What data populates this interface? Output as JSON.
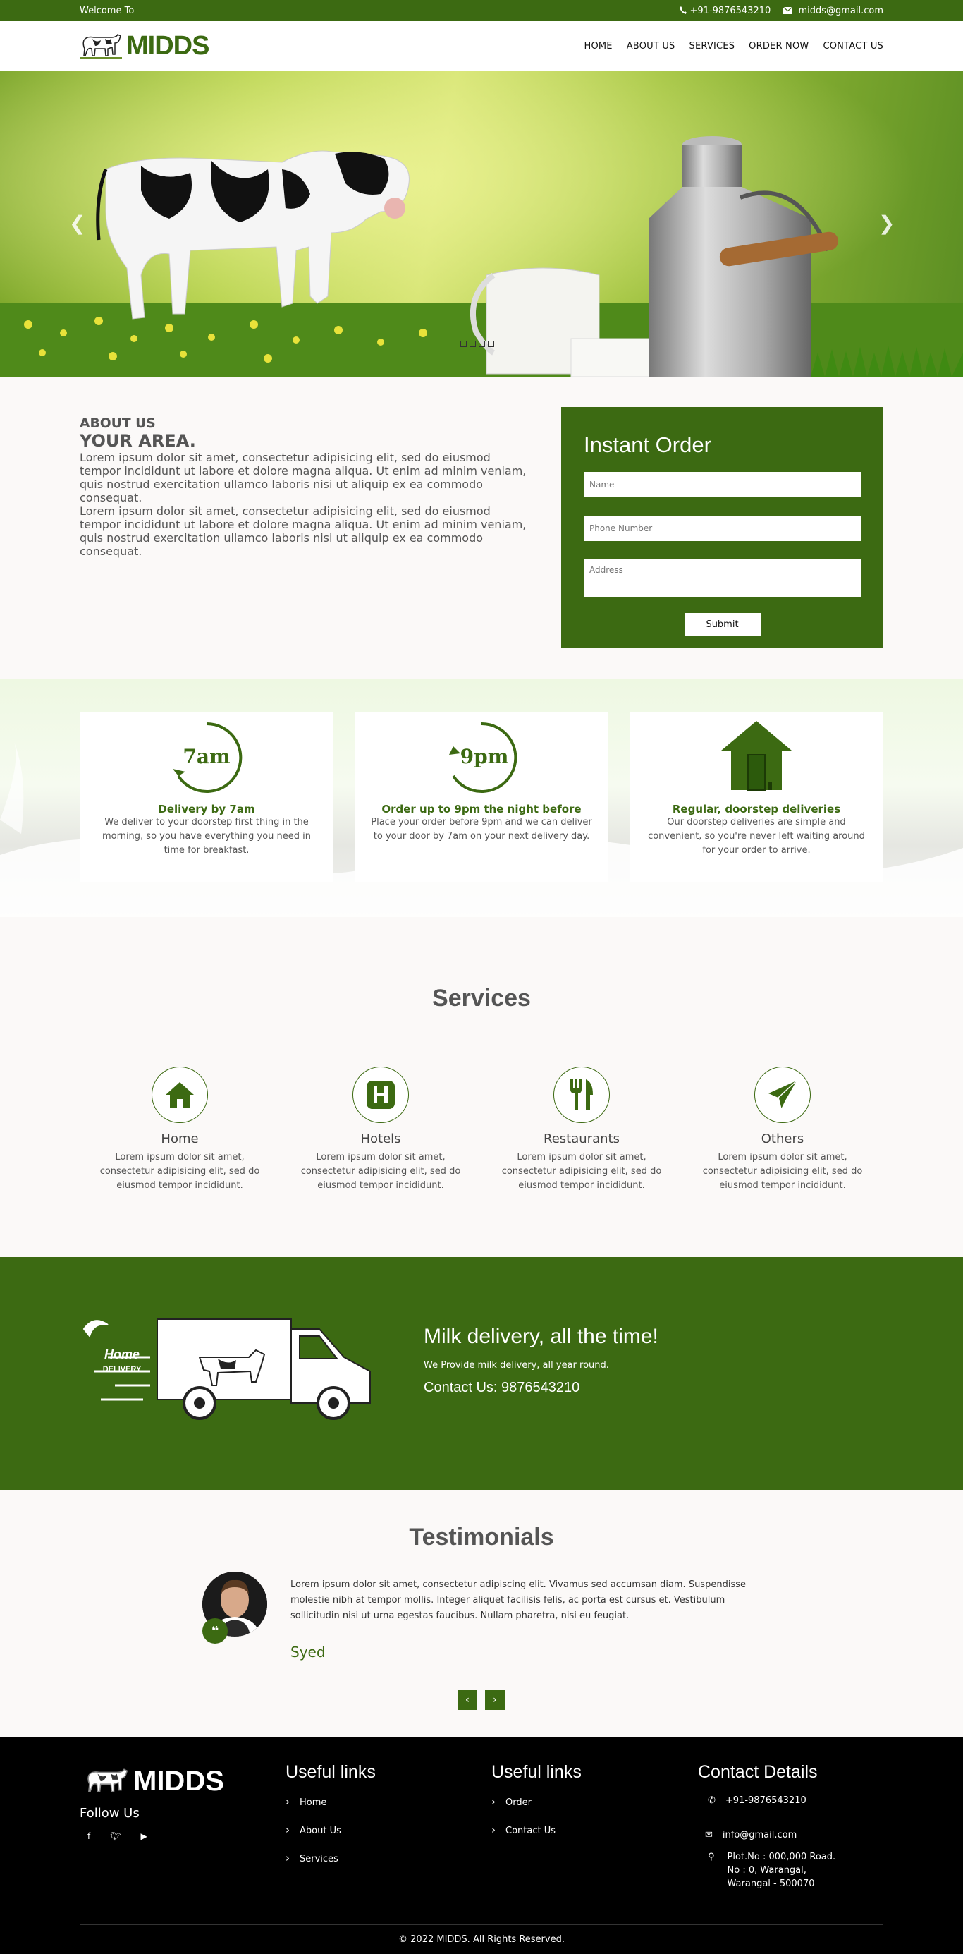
{
  "topbar": {
    "welcome": "Welcome To",
    "phone": "+91-9876543210",
    "email": "midds@gmail.com"
  },
  "brand": {
    "name": "MIDDS",
    "color": "#3c6a12"
  },
  "nav": [
    {
      "label": "HOME"
    },
    {
      "label": "ABOUT US"
    },
    {
      "label": "SERVICES"
    },
    {
      "label": "ORDER NOW"
    },
    {
      "label": "CONTACT US"
    }
  ],
  "hero": {
    "prev_icon": "chevron-left-icon",
    "next_icon": "chevron-right-icon",
    "slide_count": 4
  },
  "about": {
    "heading": "ABOUT US",
    "subheading": "YOUR AREA.",
    "p1": "Lorem ipsum dolor sit amet, consectetur adipisicing elit, sed do eiusmod tempor incididunt ut labore et dolore magna aliqua. Ut enim ad minim veniam, quis nostrud exercitation ullamco laboris nisi ut aliquip ex ea commodo consequat.",
    "p2": "Lorem ipsum dolor sit amet, consectetur adipisicing elit, sed do eiusmod tempor incididunt ut labore et dolore magna aliqua. Ut enim ad minim veniam, quis nostrud exercitation ullamco laboris nisi ut aliquip ex ea commodo consequat."
  },
  "order": {
    "title": "Instant Order",
    "name_placeholder": "Name",
    "phone_placeholder": "Phone Number",
    "address_placeholder": "Address",
    "submit": "Submit"
  },
  "features": [
    {
      "badge": "7am",
      "title": "Delivery by 7am",
      "text": "We deliver to your doorstep first thing in the morning, so you have everything you need in time for breakfast."
    },
    {
      "badge": "9pm",
      "title": "Order up to 9pm the night before",
      "text": "Place your order before 9pm and we can deliver to your door by 7am on your next delivery day."
    },
    {
      "badge": "",
      "title": "Regular, doorstep deliveries",
      "text": "Our doorstep deliveries are simple and convenient, so you're never left waiting around for your order to arrive."
    }
  ],
  "services": {
    "title": "Services",
    "items": [
      {
        "icon": "home-icon",
        "title": "Home",
        "text": "Lorem ipsum dolor sit amet, consectetur adipisicing elit, sed do eiusmod tempor incididunt."
      },
      {
        "icon": "hotel-icon",
        "title": "Hotels",
        "text": "Lorem ipsum dolor sit amet, consectetur adipisicing elit, sed do eiusmod tempor incididunt."
      },
      {
        "icon": "restaurant-icon",
        "title": "Restaurants",
        "text": "Lorem ipsum dolor sit amet, consectetur adipisicing elit, sed do eiusmod tempor incididunt."
      },
      {
        "icon": "paper-plane-icon",
        "title": "Others",
        "text": "Lorem ipsum dolor sit amet, consectetur adipisicing elit, sed do eiusmod tempor incididunt."
      }
    ]
  },
  "delivery": {
    "title": "Milk delivery, all the time!",
    "subtitle": "We Provide milk delivery, all year round.",
    "contact": "Contact Us: 9876543210",
    "van_label_1": "Home",
    "van_label_2": "DELIVERY"
  },
  "testimonials": {
    "title": "Testimonials",
    "text": "Lorem ipsum dolor sit amet, consectetur adipiscing elit. Vivamus sed accumsan diam. Suspendisse molestie nibh at tempor mollis. Integer aliquet facilisis felis, ac porta est cursus et. Vestibulum sollicitudin nisi ut urna egestas faucibus. Nullam pharetra, nisi eu feugiat.",
    "name": "Syed"
  },
  "footer": {
    "follow": "Follow Us",
    "links1_title": "Useful links",
    "links1": [
      "Home",
      "About Us",
      "Services"
    ],
    "links2_title": "Useful links",
    "links2": [
      "Order",
      "Contact Us"
    ],
    "contact_title": "Contact Details",
    "phone": "+91-9876543210",
    "email": "info@gmail.com",
    "address": "Plot.No : 000,000 Road. No : 0, Warangal, Warangal - 500070",
    "copyright": "© 2022 MIDDS. All Rights Reserved."
  }
}
